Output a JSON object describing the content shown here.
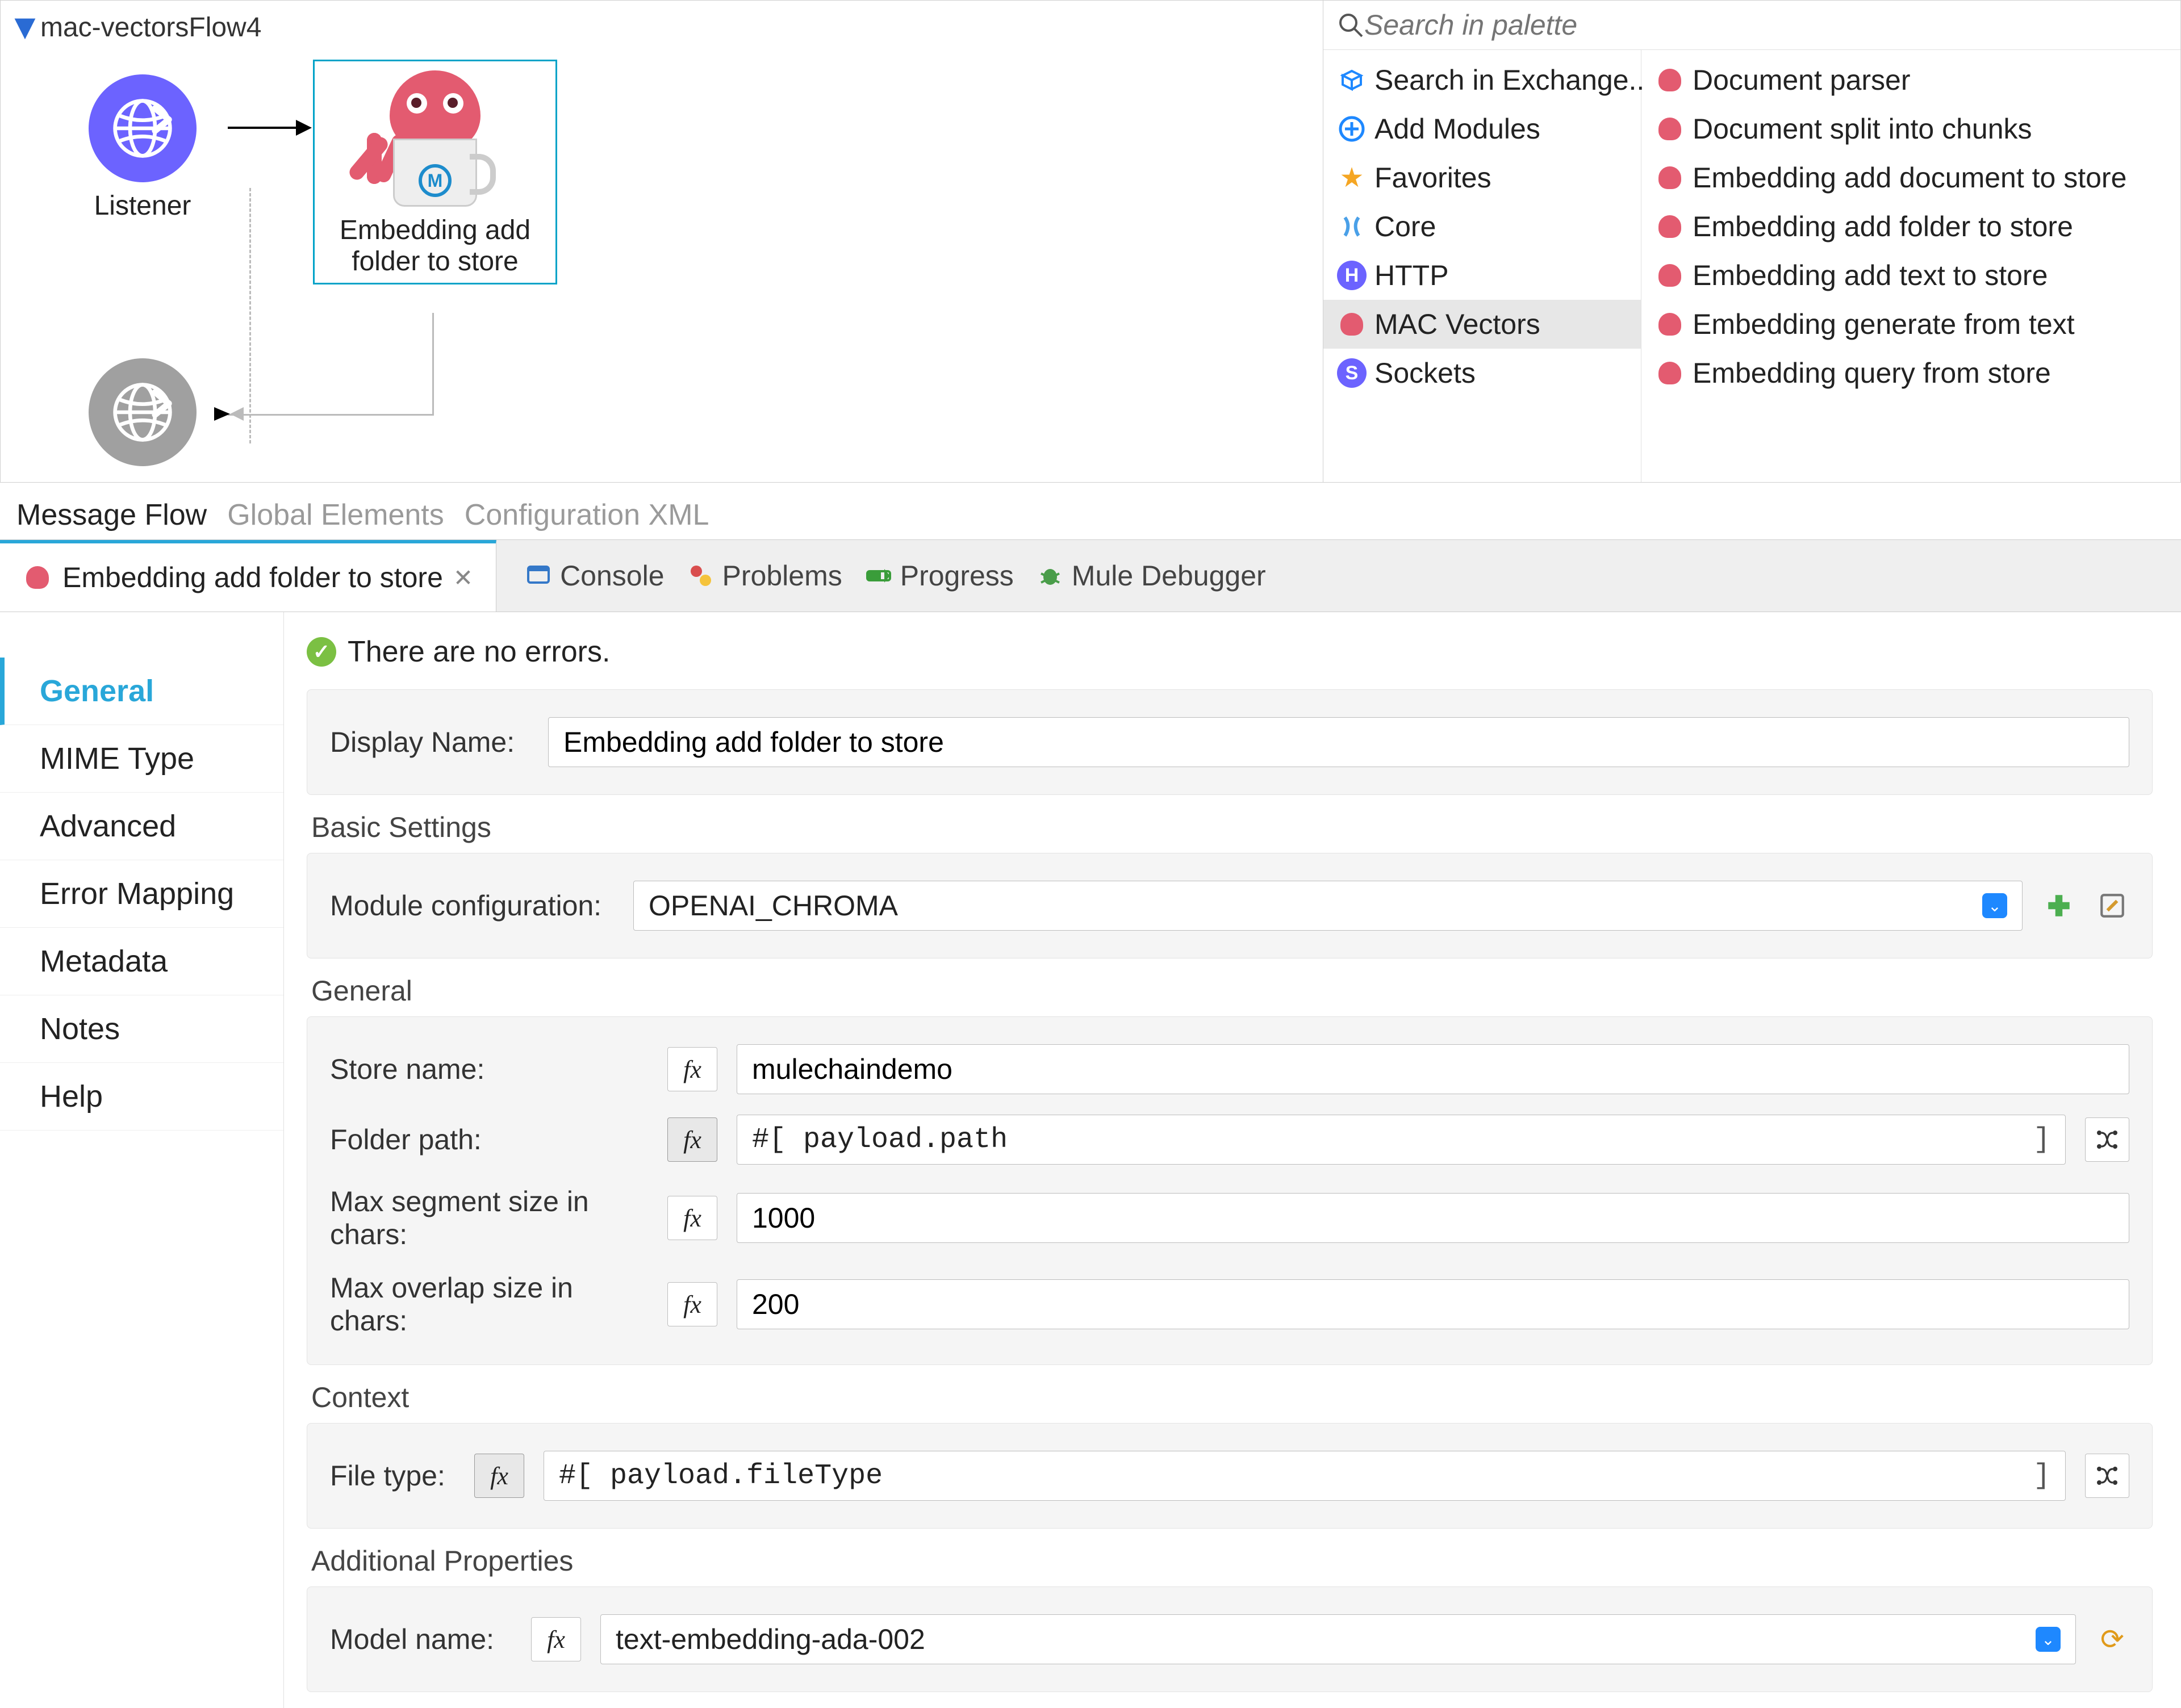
{
  "flow": {
    "name": "mac-vectorsFlow4",
    "nodes": {
      "listener_label": "Listener",
      "embed_label_l1": "Embedding add",
      "embed_label_l2": "folder to store"
    }
  },
  "editor_tabs": {
    "message_flow": "Message Flow",
    "global_elements": "Global Elements",
    "config_xml": "Configuration XML"
  },
  "palette": {
    "search_placeholder": "Search in palette",
    "left": [
      {
        "label": "Search in Exchange..",
        "icon": "exchange"
      },
      {
        "label": "Add Modules",
        "icon": "add"
      },
      {
        "label": "Favorites",
        "icon": "star"
      },
      {
        "label": "Core",
        "icon": "core"
      },
      {
        "label": "HTTP",
        "icon": "http"
      },
      {
        "label": "MAC Vectors",
        "icon": "octo",
        "selected": true
      },
      {
        "label": "Sockets",
        "icon": "sockets"
      }
    ],
    "right": [
      "Document parser",
      "Document split into chunks",
      "Embedding add document to store",
      "Embedding add folder to store",
      "Embedding add text to store",
      "Embedding generate from text",
      "Embedding query from store"
    ]
  },
  "file_tab": {
    "title": "Embedding add folder to store"
  },
  "views": {
    "console": "Console",
    "problems": "Problems",
    "progress": "Progress",
    "debugger": "Mule Debugger"
  },
  "props_nav": {
    "general": "General",
    "mime": "MIME Type",
    "advanced": "Advanced",
    "error_mapping": "Error Mapping",
    "metadata": "Metadata",
    "notes": "Notes",
    "help": "Help"
  },
  "status": {
    "ok_text": "There are no errors."
  },
  "form": {
    "display_name_label": "Display Name:",
    "display_name_value": "Embedding add folder to store",
    "basic_settings_title": "Basic Settings",
    "module_config_label": "Module configuration:",
    "module_config_value": "OPENAI_CHROMA",
    "general_title": "General",
    "store_name_label": "Store name:",
    "store_name_value": "mulechaindemo",
    "folder_path_label": "Folder path:",
    "folder_path_value": "#[ payload.path",
    "max_seg_label": "Max segment size in chars:",
    "max_seg_value": "1000",
    "max_ovl_label": "Max overlap size in chars:",
    "max_ovl_value": "200",
    "context_title": "Context",
    "file_type_label": "File type:",
    "file_type_value": "#[ payload.fileType",
    "addl_title": "Additional Properties",
    "model_name_label": "Model name:",
    "model_name_value": "text-embedding-ada-002",
    "fx_label": "fx"
  }
}
